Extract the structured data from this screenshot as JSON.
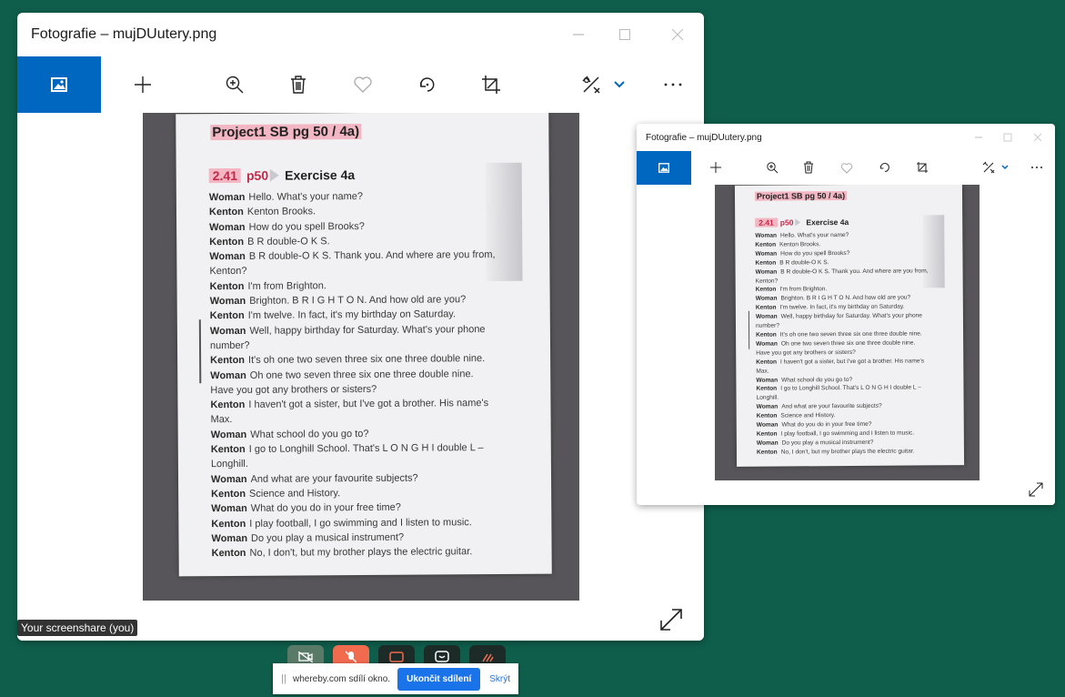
{
  "window": {
    "title": "Fotografie – mujDUutery.png",
    "controls": [
      "minimize-icon",
      "maximize-icon",
      "close-icon"
    ],
    "toolbar": [
      "photo-icon",
      "add-icon",
      "zoom-in-icon",
      "delete-icon",
      "favorite-icon",
      "rotate-icon",
      "crop-icon",
      "edit-icon",
      "chevron-down-icon",
      "more-icon"
    ],
    "more_label": "…",
    "accent": "#0067c0"
  },
  "document": {
    "header": "Project1 SB pg 50 / 4a)",
    "exercise_number": "2.41",
    "exercise_page": "p50",
    "exercise_title": "Exercise 4a",
    "lines": [
      {
        "speaker": "Woman",
        "text": "Hello. What's your name?"
      },
      {
        "speaker": "Kenton",
        "text": "Kenton Brooks."
      },
      {
        "speaker": "Woman",
        "text": "How do you spell Brooks?"
      },
      {
        "speaker": "Kenton",
        "text": "B R double-O K S."
      },
      {
        "speaker": "Woman",
        "text": "B R double-O K S. Thank you. And where are you from,"
      },
      {
        "speaker": "",
        "text": "Kenton?"
      },
      {
        "speaker": "Kenton",
        "text": "I'm from Brighton."
      },
      {
        "speaker": "Woman",
        "text": "Brighton. B R I G H T O N. And how old are you?"
      },
      {
        "speaker": "Kenton",
        "text": "I'm twelve. In fact, it's my birthday on Saturday."
      },
      {
        "speaker": "Woman",
        "text": "Well, happy birthday for Saturday. What's your phone"
      },
      {
        "speaker": "",
        "text": "number?"
      },
      {
        "speaker": "Kenton",
        "text": "It's oh one two seven three six one three double nine."
      },
      {
        "speaker": "Woman",
        "text": "Oh one two seven three six one three double nine."
      },
      {
        "speaker": "",
        "text": "Have you got any brothers or sisters?"
      },
      {
        "speaker": "Kenton",
        "text": "I haven't got a sister, but I've got a brother. His name's"
      },
      {
        "speaker": "",
        "text": "Max."
      },
      {
        "speaker": "Woman",
        "text": "What school do you go to?"
      },
      {
        "speaker": "Kenton",
        "text": "I go to Longhill School. That's L O N G H I double L –"
      },
      {
        "speaker": "",
        "text": "Longhill."
      },
      {
        "speaker": "Woman",
        "text": "And what are your favourite subjects?"
      },
      {
        "speaker": "Kenton",
        "text": "Science and History."
      },
      {
        "speaker": "Woman",
        "text": "What do you do in your free time?"
      },
      {
        "speaker": "Kenton",
        "text": "I play football, I go swimming and I listen to music."
      },
      {
        "speaker": "Woman",
        "text": "Do you play a musical instrument?"
      },
      {
        "speaker": "Kenton",
        "text": "No, I don't, but my brother plays the electric guitar."
      }
    ]
  },
  "screenshare_badge": "Your screenshare (you)",
  "meeting_controls": [
    {
      "name": "camera-off-icon",
      "color": "#5a7a68"
    },
    {
      "name": "mic-off-icon",
      "color": "#f26b4f"
    },
    {
      "name": "share-screen-icon",
      "color": "#1c2b27"
    },
    {
      "name": "chat-icon",
      "color": "#1c2b27"
    },
    {
      "name": "reactions-icon",
      "color": "#1c2b27"
    }
  ],
  "sharebar": {
    "grip": "||",
    "message": "whereby.com sdílí okno.",
    "stop_label": "Ukončit sdílení",
    "hide_label": "Skrýt"
  }
}
